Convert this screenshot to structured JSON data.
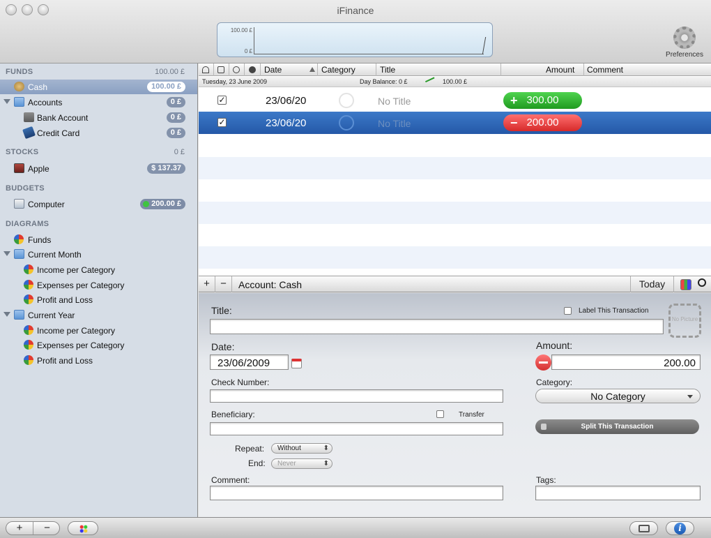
{
  "window": {
    "title": "iFinance"
  },
  "toolbar": {
    "graph_top_label": "100.00 £",
    "graph_bottom_label": "0 £",
    "preferences_label": "Preferences"
  },
  "sidebar": {
    "funds": {
      "header": "FUNDS",
      "total": "100.00 £"
    },
    "cash": {
      "label": "Cash",
      "value": "100.00 £"
    },
    "accounts": {
      "label": "Accounts",
      "value": "0 £"
    },
    "bank_account": {
      "label": "Bank Account",
      "value": "0 £"
    },
    "credit_card": {
      "label": "Credit Card",
      "value": "0 £"
    },
    "stocks": {
      "header": "STOCKS",
      "total": "0 £"
    },
    "apple": {
      "label": "Apple",
      "value": "$ 137.37"
    },
    "budgets": {
      "header": "BUDGETS"
    },
    "computer": {
      "label": "Computer",
      "value": "200.00 £"
    },
    "diagrams": {
      "header": "DIAGRAMS"
    },
    "funds_diagram": {
      "label": "Funds"
    },
    "current_month": {
      "label": "Current Month"
    },
    "cm_income": {
      "label": "Income per Category"
    },
    "cm_expenses": {
      "label": "Expenses per Category"
    },
    "cm_profit": {
      "label": "Profit and Loss"
    },
    "current_year": {
      "label": "Current Year"
    },
    "cy_income": {
      "label": "Income per Category"
    },
    "cy_expenses": {
      "label": "Expenses per Category"
    },
    "cy_profit": {
      "label": "Profit and Loss"
    }
  },
  "table": {
    "columns": {
      "date": "Date",
      "category": "Category",
      "title": "Title",
      "amount": "Amount",
      "comment": "Comment"
    },
    "day_header": {
      "date": "Tuesday, 23 June 2009",
      "balance_label": "Day Balance: 0 £",
      "balance_value": "100.00 £"
    },
    "rows": [
      {
        "checked": "✓",
        "date": "23/06/20",
        "title": "No Title",
        "sign": "+",
        "amount": "300.00"
      },
      {
        "checked": "✓",
        "date": "23/06/20",
        "title": "No Title",
        "sign": "−",
        "amount": "200.00"
      }
    ]
  },
  "footer": {
    "add": "+",
    "remove": "−",
    "account": "Account: Cash",
    "today": "Today"
  },
  "detail": {
    "title_label": "Title:",
    "title_value": "",
    "label_transaction": "Label This Transaction",
    "no_picture": "No Picture",
    "date_label": "Date:",
    "date_value": "23/06/2009",
    "amount_label": "Amount:",
    "amount_value": "200.00",
    "check_number_label": "Check Number:",
    "category_label": "Category:",
    "category_value": "No Category",
    "beneficiary_label": "Beneficiary:",
    "transfer_label": "Transfer",
    "split_label": "Split This Transaction",
    "repeat_label": "Repeat:",
    "repeat_value": "Without",
    "end_label": "End:",
    "end_value": "Never",
    "comment_label": "Comment:",
    "tags_label": "Tags:"
  },
  "bottom": {
    "add": "+",
    "remove": "−",
    "info": "i"
  }
}
